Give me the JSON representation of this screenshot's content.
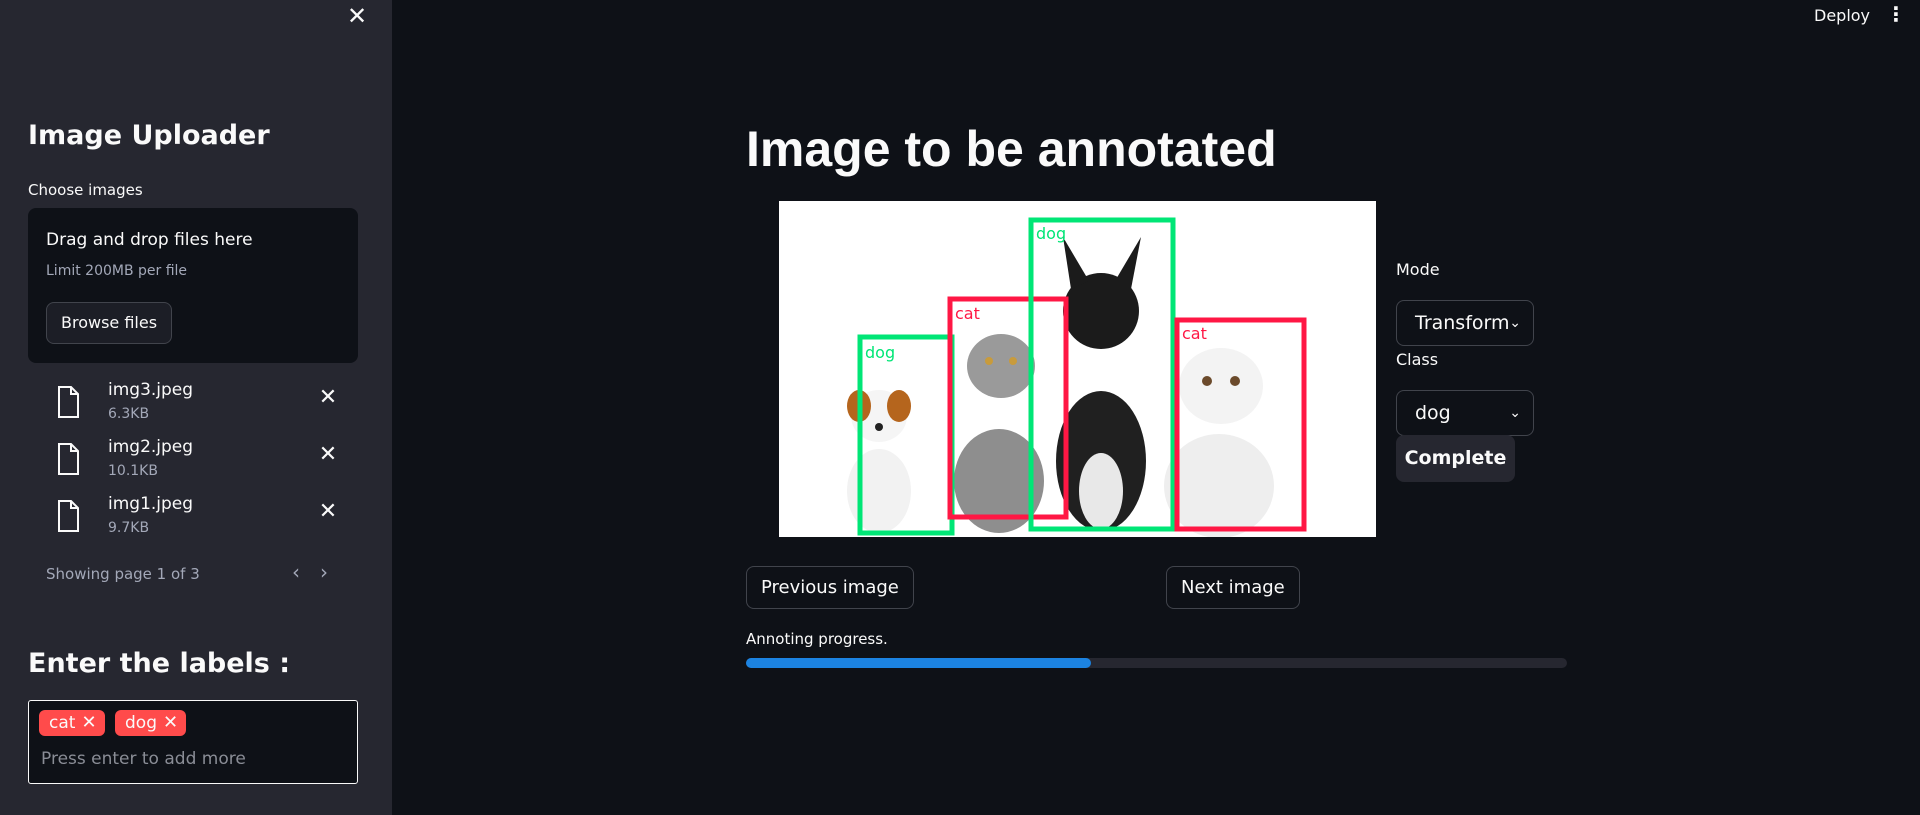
{
  "sidebar": {
    "close_icon": "close-icon",
    "title": "Image Uploader",
    "choose_label": "Choose images",
    "dropzone": {
      "title": "Drag and drop files here",
      "limit": "Limit 200MB per file",
      "browse_label": "Browse files"
    },
    "files": [
      {
        "name": "img3.jpeg",
        "size": "6.3KB"
      },
      {
        "name": "img2.jpeg",
        "size": "10.1KB"
      },
      {
        "name": "img1.jpeg",
        "size": "9.7KB"
      }
    ],
    "pagination": "Showing page 1 of 3",
    "labels_title": "Enter the labels :",
    "tags": [
      "cat",
      "dog"
    ],
    "tag_placeholder": "Press enter to add more"
  },
  "header": {
    "deploy_label": "Deploy",
    "menu_icon": "kebab-menu-icon"
  },
  "main": {
    "title": "Image to be annotated",
    "annotations": [
      {
        "label": "dog",
        "color": "#00e676"
      },
      {
        "label": "cat",
        "color": "#ff1744"
      },
      {
        "label": "dog",
        "color": "#00e676"
      },
      {
        "label": "cat",
        "color": "#ff1744"
      }
    ],
    "mode_label": "Mode",
    "mode_value": "Transform",
    "class_label": "Class",
    "class_value": "dog",
    "complete_label": "Complete",
    "prev_label": "Previous image",
    "next_label": "Next image",
    "progress_label": "Annoting progress.",
    "progress_fraction": 0.42
  },
  "colors": {
    "accent": "#ff4b4b",
    "progress": "#1c83e1",
    "background": "#0e1117",
    "sidebar": "#262730"
  }
}
